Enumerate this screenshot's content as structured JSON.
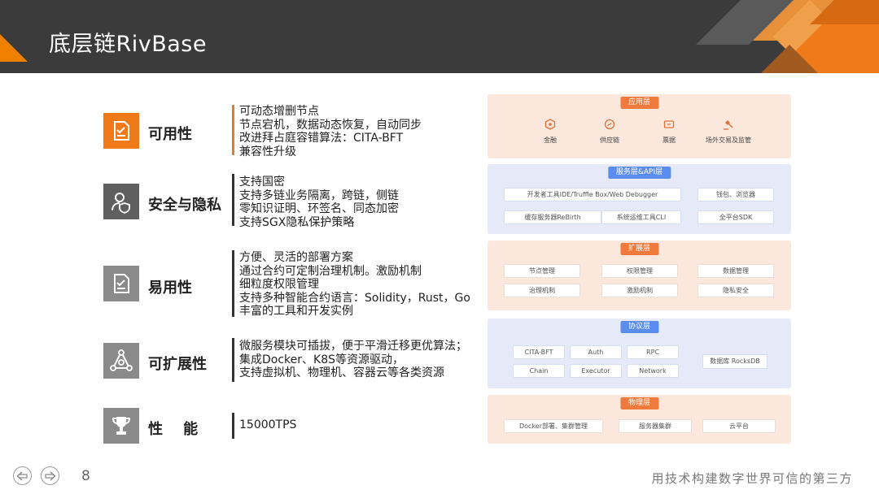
{
  "slide": {
    "title": "底层链RivBase",
    "page_number": "8",
    "slogan": "用技术构建数字世界可信的第三方"
  },
  "features": [
    {
      "label": "可用性",
      "icon": "checklist-icon",
      "lines": [
        "可动态增删节点",
        "节点宕机，数据动态恢复，自动同步",
        "改进拜占庭容错算法：CITA-BFT",
        "兼容性升级"
      ]
    },
    {
      "label": "安全与隐私",
      "icon": "user-shield-icon",
      "lines": [
        "支持国密",
        "支持多链业务隔离，跨链，侧链",
        "零知识证明、环签名、同态加密",
        "支持SGX隐私保护策略"
      ]
    },
    {
      "label": "易用性",
      "icon": "checklist-icon",
      "lines": [
        "方便、灵活的部署方案",
        "通过合约可定制治理机制。激励机制",
        "细粒度权限管理",
        "支持多种智能合约语言：Solidity，Rust，Go",
        "丰富的工具和开发实例"
      ]
    },
    {
      "label": "可扩展性",
      "icon": "network-icon",
      "lines": [
        "微服务模块可插拔，便于平滑迁移更优算法；",
        "集成Docker、K8S等资源驱动，",
        "支持虚拟机、物理机、容器云等各类资源"
      ]
    },
    {
      "label": "性    能",
      "icon": "trophy-icon",
      "lines": [
        "15000TPS"
      ]
    }
  ],
  "architecture": {
    "app_layer": {
      "tag": "应用层",
      "items": [
        {
          "label": "金融",
          "icon": "finance-icon"
        },
        {
          "label": "供应链",
          "icon": "supply-chain-icon"
        },
        {
          "label": "票据",
          "icon": "ticket-icon"
        },
        {
          "label": "场外交易及监管",
          "icon": "gavel-icon"
        }
      ]
    },
    "service_layer": {
      "tag": "服务层&API层",
      "boxes": [
        "开发者工具IDE/Truffle Box/Web Debugger",
        "钱包、浏览器",
        "缓存服务器ReBirth",
        "系统运维工具CLI",
        "全平台SDK"
      ]
    },
    "extension_layer": {
      "tag": "扩展层",
      "boxes": [
        "节点管理",
        "权限管理",
        "数据管理",
        "治理机制",
        "激励机制",
        "隐私安全"
      ]
    },
    "protocol_layer": {
      "tag": "协议层",
      "boxes": [
        "CITA-BFT",
        "Auth",
        "RPC",
        "Chain",
        "Executor",
        "Network",
        "数据库 RocksDB"
      ]
    },
    "physical_layer": {
      "tag": "物理层",
      "boxes": [
        "Docker部署、集群管理",
        "服务器集群",
        "云平台"
      ]
    }
  },
  "colors": {
    "header_bg": "#3b3b3b",
    "accent_orange": "#f07a1a",
    "icon_gray": "#6f6f6f",
    "layer_peach": "#fbe7dc",
    "layer_blue": "#e6eaf8"
  }
}
